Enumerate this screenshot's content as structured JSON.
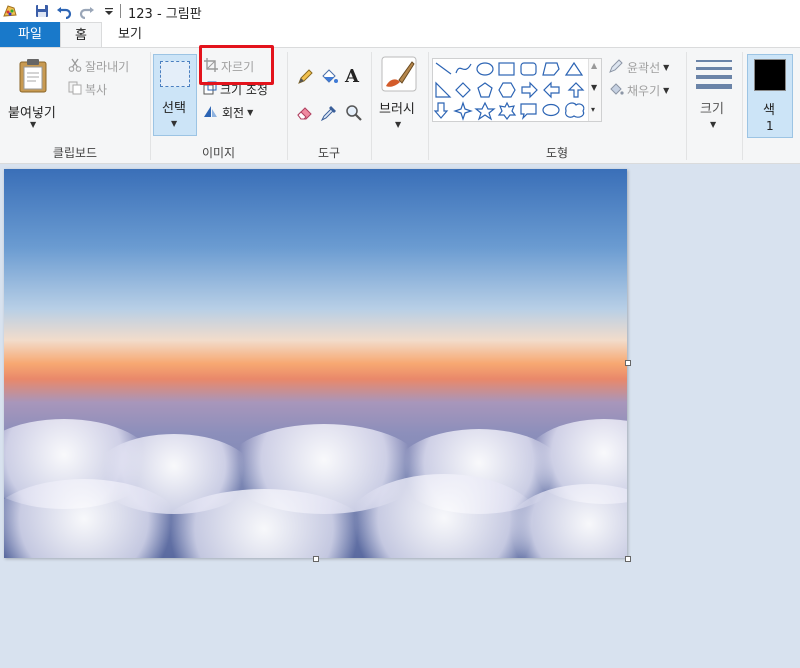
{
  "title_bar": {
    "title": "123 - 그림판"
  },
  "tabs": [
    {
      "label": "파일"
    },
    {
      "label": "홈"
    },
    {
      "label": "보기"
    }
  ],
  "ribbon": {
    "clipboard": {
      "paste_label": "붙여넣기",
      "cut_label": "잘라내기",
      "copy_label": "복사",
      "group_label": "클립보드"
    },
    "image": {
      "select_label": "선택",
      "crop_label": "자르기",
      "resize_label": "크기 조정",
      "rotate_label": "회전",
      "group_label": "이미지"
    },
    "tools": {
      "group_label": "도구"
    },
    "brushes": {
      "label": "브러시"
    },
    "shapes": {
      "outline_label": "윤곽선",
      "fill_label": "채우기",
      "group_label": "도형"
    },
    "size": {
      "label": "크기"
    },
    "color": {
      "label": "색",
      "number": "1",
      "value": "#000000"
    }
  },
  "colors": {
    "file_tab": "#1979ca",
    "highlight": "#e3131c",
    "workspace": "#d8e2ef"
  }
}
